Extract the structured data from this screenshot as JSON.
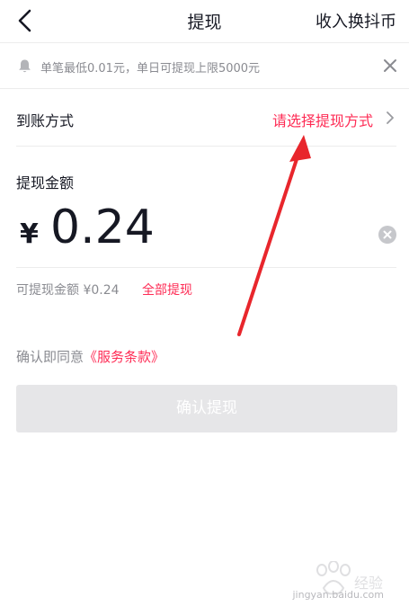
{
  "header": {
    "title": "提现",
    "right_link": "收入换抖币"
  },
  "notice": {
    "text": "单笔最低0.01元，单日可提现上限5000元"
  },
  "method": {
    "label": "到账方式",
    "placeholder": "请选择提现方式"
  },
  "amount": {
    "label": "提现金额",
    "currency": "¥",
    "value": "0.24"
  },
  "available": {
    "text": "可提现金额 ¥0.24",
    "withdraw_all": "全部提现"
  },
  "agreement": {
    "prefix": "确认即同意",
    "link": "《服务条款》"
  },
  "confirm_button": "确认提现",
  "watermark": {
    "text": "jingyan.baidu.com"
  },
  "colors": {
    "accent": "#fe2c55",
    "annotation_arrow": "#e8262c",
    "disabled_button": "#e6e6e8"
  },
  "icons": {
    "back": "chevron-left-icon",
    "bell": "bell-icon",
    "close": "close-icon",
    "chevron": "chevron-right-icon",
    "clear": "clear-circle-icon"
  }
}
